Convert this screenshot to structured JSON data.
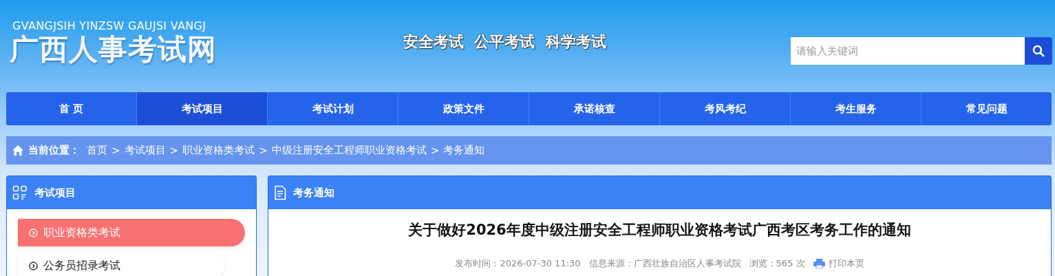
{
  "header": {
    "logo_pinyin": "GVANGJSIH YINZSW GAUJSI VANGJ",
    "logo_title": "广西人事考试网",
    "slogan": "安全考试  公平考试  科学考试",
    "search": {
      "placeholder": "请输入关键词"
    }
  },
  "nav": [
    {
      "label": "首 页",
      "selected": false
    },
    {
      "label": "考试项目",
      "selected": true
    },
    {
      "label": "考试计划",
      "selected": false
    },
    {
      "label": "政策文件",
      "selected": false
    },
    {
      "label": "承诺核查",
      "selected": false
    },
    {
      "label": "考风考纪",
      "selected": false
    },
    {
      "label": "考生服务",
      "selected": false
    },
    {
      "label": "常见问题",
      "selected": false
    }
  ],
  "breadcrumb": {
    "label": "当前位置：",
    "separator": ">",
    "items": [
      "首页",
      "考试项目",
      "职业资格类考试",
      "中级注册安全工程师职业资格考试",
      "考务通知"
    ]
  },
  "sidebar": {
    "title": "考试项目",
    "items": [
      {
        "label": "职业资格类考试",
        "selected": true
      },
      {
        "label": "公务员招录考试",
        "selected": false
      }
    ]
  },
  "article": {
    "section_title": "考务通知",
    "title": "关于做好2026年度中级注册安全工程师职业资格考试广西考区考务工作的通知",
    "published": "发布时间：2026-07-30 11:30",
    "source": "信息来源：广西壮族自治区人事考试院",
    "views_label": "浏览：",
    "views": "565",
    "views_unit": "次",
    "print": "打印本页"
  }
}
